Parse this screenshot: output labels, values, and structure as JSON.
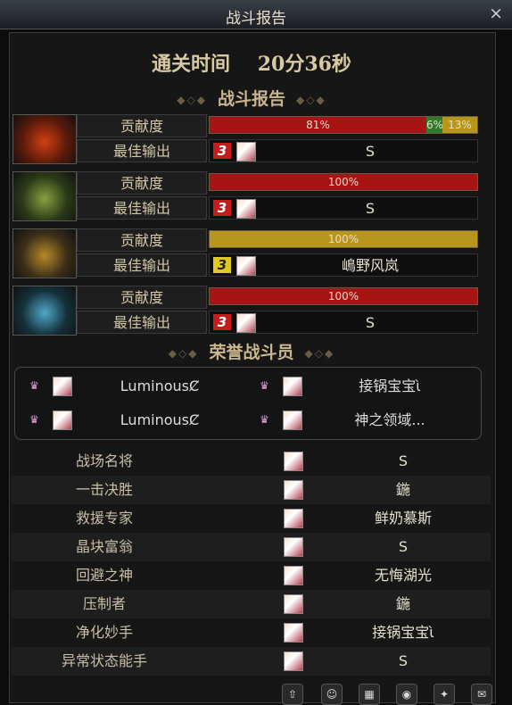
{
  "window": {
    "title": "战斗报告",
    "close_label": "×"
  },
  "clear_time": {
    "label": "通关时间",
    "value": "20分36秒"
  },
  "battle_report_heading": "战斗报告",
  "stages": [
    {
      "contribution_label": "贡献度",
      "segments": [
        {
          "text": "81%",
          "percent": 81,
          "color": "#a61414"
        },
        {
          "text": "6%",
          "percent": 6,
          "color": "#2f7a2a"
        },
        {
          "text": "13%",
          "percent": 13,
          "color": "#b8961e"
        }
      ],
      "best_label": "最佳输出",
      "rank": "3",
      "rank_color": "red",
      "best_name": "S"
    },
    {
      "contribution_label": "贡献度",
      "segments": [
        {
          "text": "100%",
          "percent": 100,
          "color": "#a61414"
        }
      ],
      "best_label": "最佳输出",
      "rank": "3",
      "rank_color": "red",
      "best_name": "S"
    },
    {
      "contribution_label": "贡献度",
      "segments": [
        {
          "text": "100%",
          "percent": 100,
          "color": "#b8961e"
        }
      ],
      "best_label": "最佳输出",
      "rank": "3",
      "rank_color": "yellow",
      "best_name": "嶋野风岚"
    },
    {
      "contribution_label": "贡献度",
      "segments": [
        {
          "text": "100%",
          "percent": 100,
          "color": "#a61414"
        }
      ],
      "best_label": "最佳输出",
      "rank": "3",
      "rank_color": "red",
      "best_name": "S"
    }
  ],
  "honor_heading": "荣誉战斗员",
  "honor": [
    {
      "name": "LuminousȻ"
    },
    {
      "name": "接锅宝宝ὶ"
    },
    {
      "name": "LuminousȻ"
    },
    {
      "name": "神之领域..."
    }
  ],
  "awards": [
    {
      "label": "战场名将",
      "name": "S"
    },
    {
      "label": "一击决胜",
      "name": "鍦"
    },
    {
      "label": "救援专家",
      "name": "鲜奶慕斯"
    },
    {
      "label": "晶块富翁",
      "name": "S"
    },
    {
      "label": "回避之神",
      "name": "无悔湖光"
    },
    {
      "label": "压制者",
      "name": "鍦"
    },
    {
      "label": "净化妙手",
      "name": "接锅宝宝ὶ"
    },
    {
      "label": "异常状态能手",
      "name": "S"
    }
  ],
  "taskbar_icons": [
    "upgrade-icon",
    "character-icon",
    "calendar-icon",
    "pet-icon",
    "gift-icon",
    "mail-icon"
  ]
}
